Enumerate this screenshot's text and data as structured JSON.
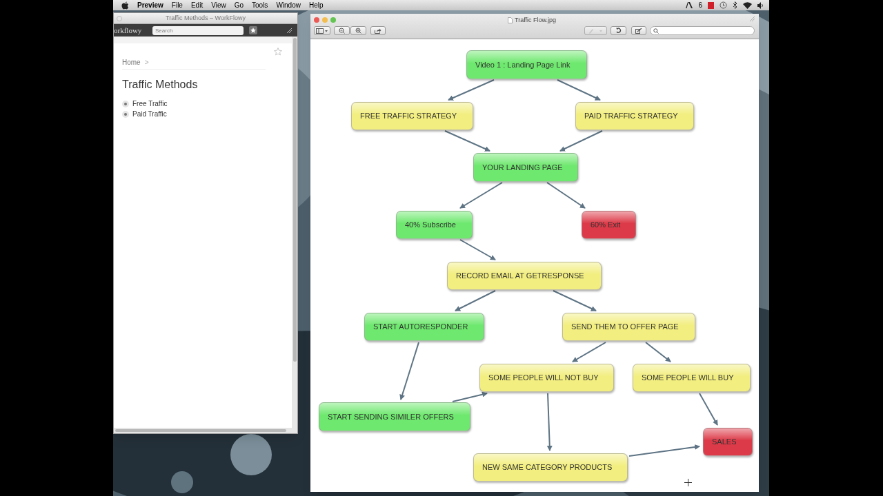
{
  "menu_bar": {
    "app": "Preview",
    "menus": [
      "File",
      "Edit",
      "View",
      "Go",
      "Tools",
      "Window",
      "Help"
    ],
    "status_text": "6"
  },
  "workflowy": {
    "title": "Traffic Methods – WorkFlowy",
    "logo": "orkflowy",
    "search": {
      "placeholder": "Search"
    },
    "breadcrumb": [
      "Home",
      ">"
    ],
    "heading": "Traffic Methods",
    "items": [
      {
        "label": "Free Traffic"
      },
      {
        "label": "Paid Traffic"
      }
    ]
  },
  "preview": {
    "title": "Traffic Flow.jpg",
    "nodes": [
      {
        "label": "Video 1 : Landing Page Link",
        "color": "#6ee86e"
      },
      {
        "label": "FREE TRAFFIC STRATEGY",
        "color": "#f2ee80"
      },
      {
        "label": "PAID TRAFFIC STRATEGY",
        "color": "#f2ee80"
      },
      {
        "label": "YOUR LANDING PAGE",
        "color": "#6ee86e"
      },
      {
        "label": "40% Subscribe",
        "color": "#6ee86e"
      },
      {
        "label": "60% Exit",
        "color": "#dc3a48"
      },
      {
        "label": "RECORD EMAIL AT GETRESPONSE",
        "color": "#f2ee80"
      },
      {
        "label": "START AUTORESPONDER",
        "color": "#6ee86e"
      },
      {
        "label": "SEND THEM TO OFFER PAGE",
        "color": "#f2ee80"
      },
      {
        "label": "SOME PEOPLE WILL NOT BUY",
        "color": "#f2ee80"
      },
      {
        "label": "SOME PEOPLE WILL BUY",
        "color": "#f2ee80"
      },
      {
        "label": "START SENDING SIMILER OFFERS",
        "color": "#6ee86e"
      },
      {
        "label": "SALES",
        "color": "#dc3a48"
      },
      {
        "label": "NEW SAME CATEGORY PRODUCTS",
        "color": "#f2ee80"
      }
    ]
  }
}
